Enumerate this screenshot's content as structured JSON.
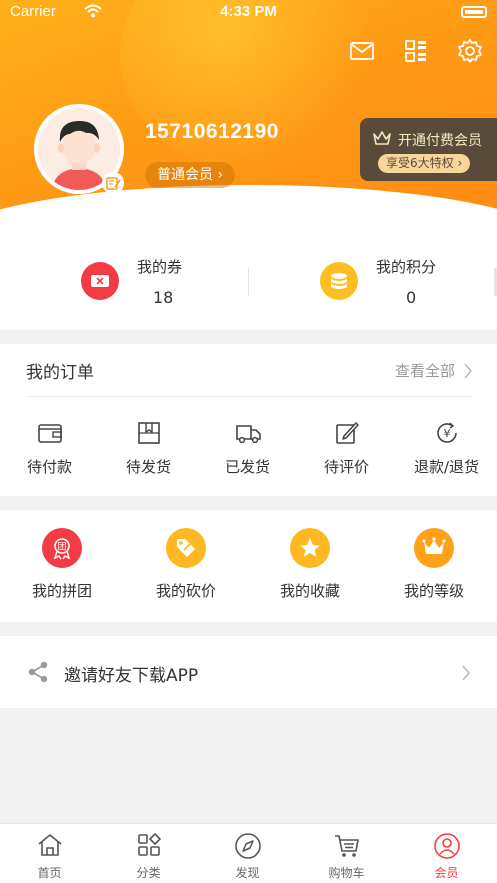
{
  "status": {
    "carrier": "Carrier",
    "time": "4:33 PM"
  },
  "header": {
    "phone": "15710612190",
    "member_level": "普通会员",
    "vip_title": "开通付费会员",
    "vip_pill": "享受6大特权"
  },
  "stats": {
    "coupons": {
      "label": "我的券",
      "value": "18"
    },
    "points": {
      "label": "我的积分",
      "value": "0"
    }
  },
  "orders": {
    "title": "我的订单",
    "more": "查看全部",
    "items": [
      {
        "label": "待付款",
        "icon": "wallet-icon"
      },
      {
        "label": "待发货",
        "icon": "box-icon"
      },
      {
        "label": "已发货",
        "icon": "truck-icon"
      },
      {
        "label": "待评价",
        "icon": "edit-icon"
      },
      {
        "label": "退款/退货",
        "icon": "refund-icon"
      }
    ]
  },
  "services": {
    "items": [
      {
        "label": "我的拼团",
        "icon": "group-badge-icon",
        "color": "#f23b44"
      },
      {
        "label": "我的砍价",
        "icon": "tag-icon",
        "color": "#ffb821"
      },
      {
        "label": "我的收藏",
        "icon": "star-icon",
        "color": "#ffb821"
      },
      {
        "label": "我的等级",
        "icon": "crown-icon",
        "color": "#ffa21a"
      }
    ]
  },
  "invite": {
    "label": "邀请好友下载APP"
  },
  "tabbar": {
    "items": [
      {
        "label": "首页",
        "icon": "home-icon"
      },
      {
        "label": "分类",
        "icon": "category-icon"
      },
      {
        "label": "发现",
        "icon": "compass-icon"
      },
      {
        "label": "购物车",
        "icon": "cart-icon"
      },
      {
        "label": "会员",
        "icon": "user-icon"
      }
    ],
    "active_color": "#ff3b3b"
  },
  "colors": {
    "accent": "#ff9b15",
    "vip_dark": "#5a4a3a",
    "vip_gold": "#f8d59a"
  }
}
